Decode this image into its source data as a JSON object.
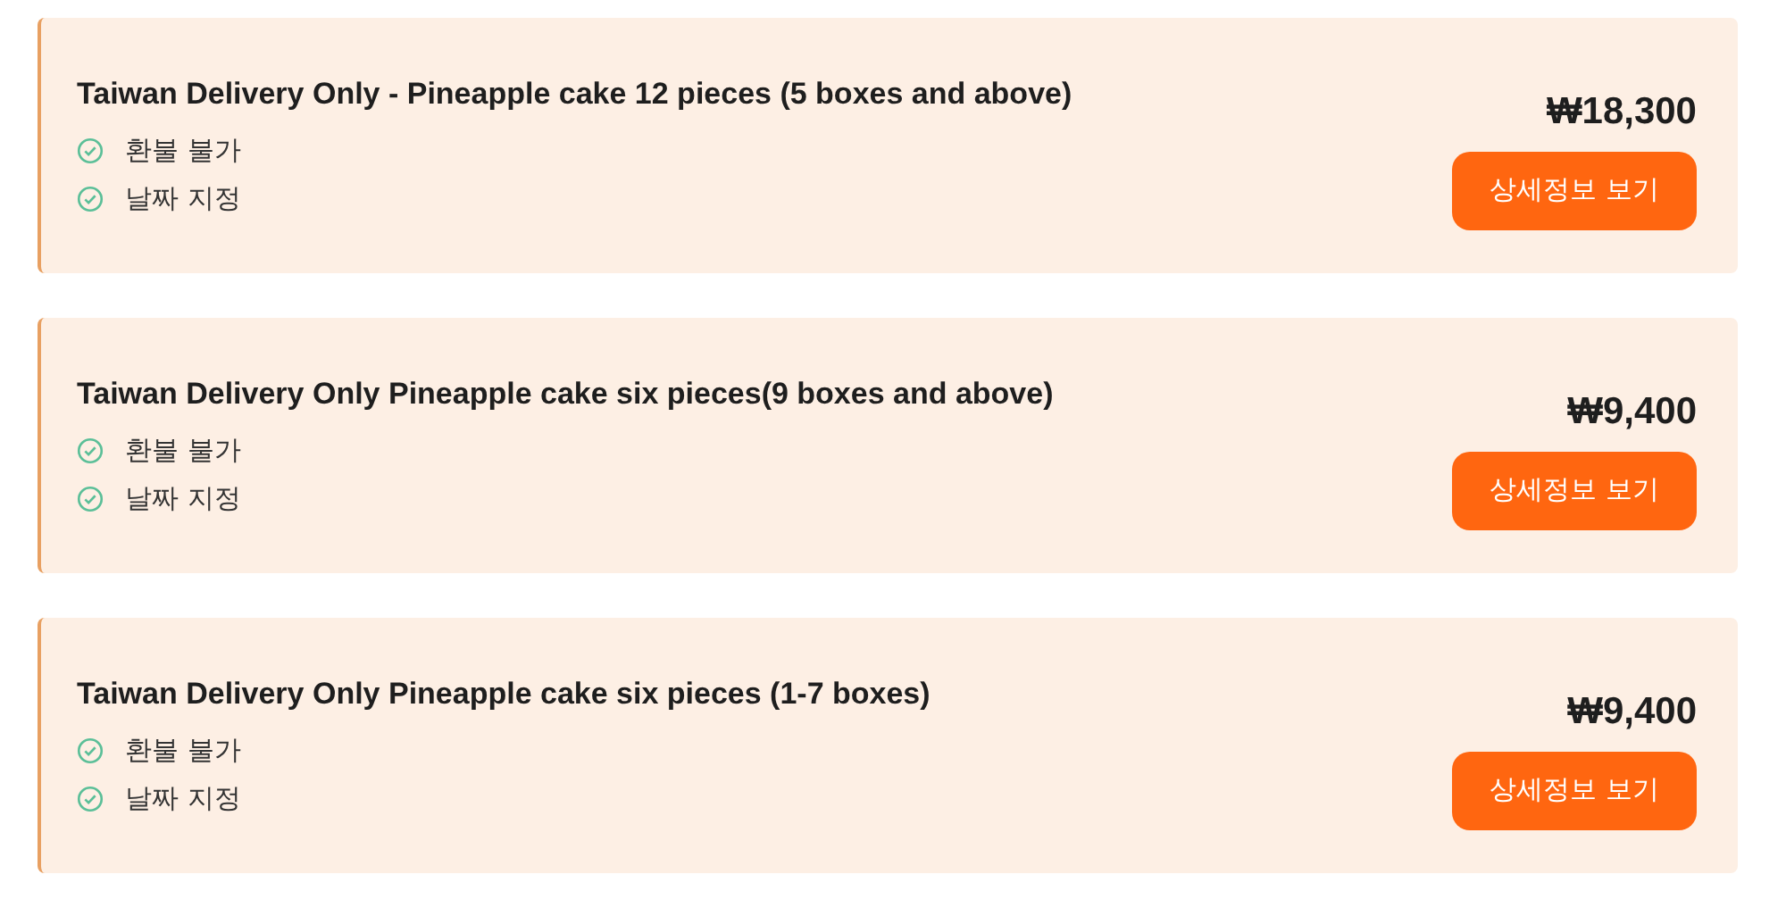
{
  "products": [
    {
      "title": "Taiwan Delivery Only - Pineapple cake 12 pieces (5 boxes and above)",
      "features": [
        "환불 불가",
        "날짜 지정"
      ],
      "price": "₩18,300",
      "button": "상세정보 보기"
    },
    {
      "title": "Taiwan Delivery Only Pineapple cake six pieces(9 boxes and above)",
      "features": [
        "환불 불가",
        "날짜 지정"
      ],
      "price": "₩9,400",
      "button": "상세정보 보기"
    },
    {
      "title": "Taiwan Delivery Only Pineapple cake six pieces (1-7 boxes)",
      "features": [
        "환불 불가",
        "날짜 지정"
      ],
      "price": "₩9,400",
      "button": "상세정보 보기"
    }
  ]
}
